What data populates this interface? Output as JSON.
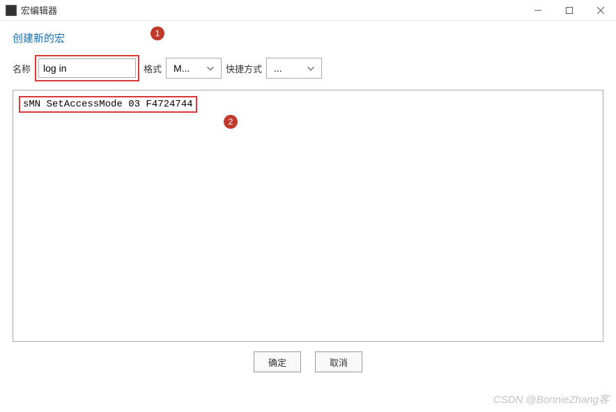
{
  "window": {
    "title": "宏编辑器"
  },
  "section": {
    "heading": "创建新的宏"
  },
  "form": {
    "name_label": "名称",
    "name_value": "log in",
    "format_label": "格式",
    "format_value": "M...",
    "shortcut_label": "快捷方式",
    "shortcut_value": "..."
  },
  "editor": {
    "content": "sMN SetAccessMode 03 F4724744"
  },
  "annotations": {
    "badge1": "1",
    "badge2": "2"
  },
  "buttons": {
    "ok": "确定",
    "cancel": "取消"
  },
  "watermark": "CSDN @BonnieZhang客"
}
